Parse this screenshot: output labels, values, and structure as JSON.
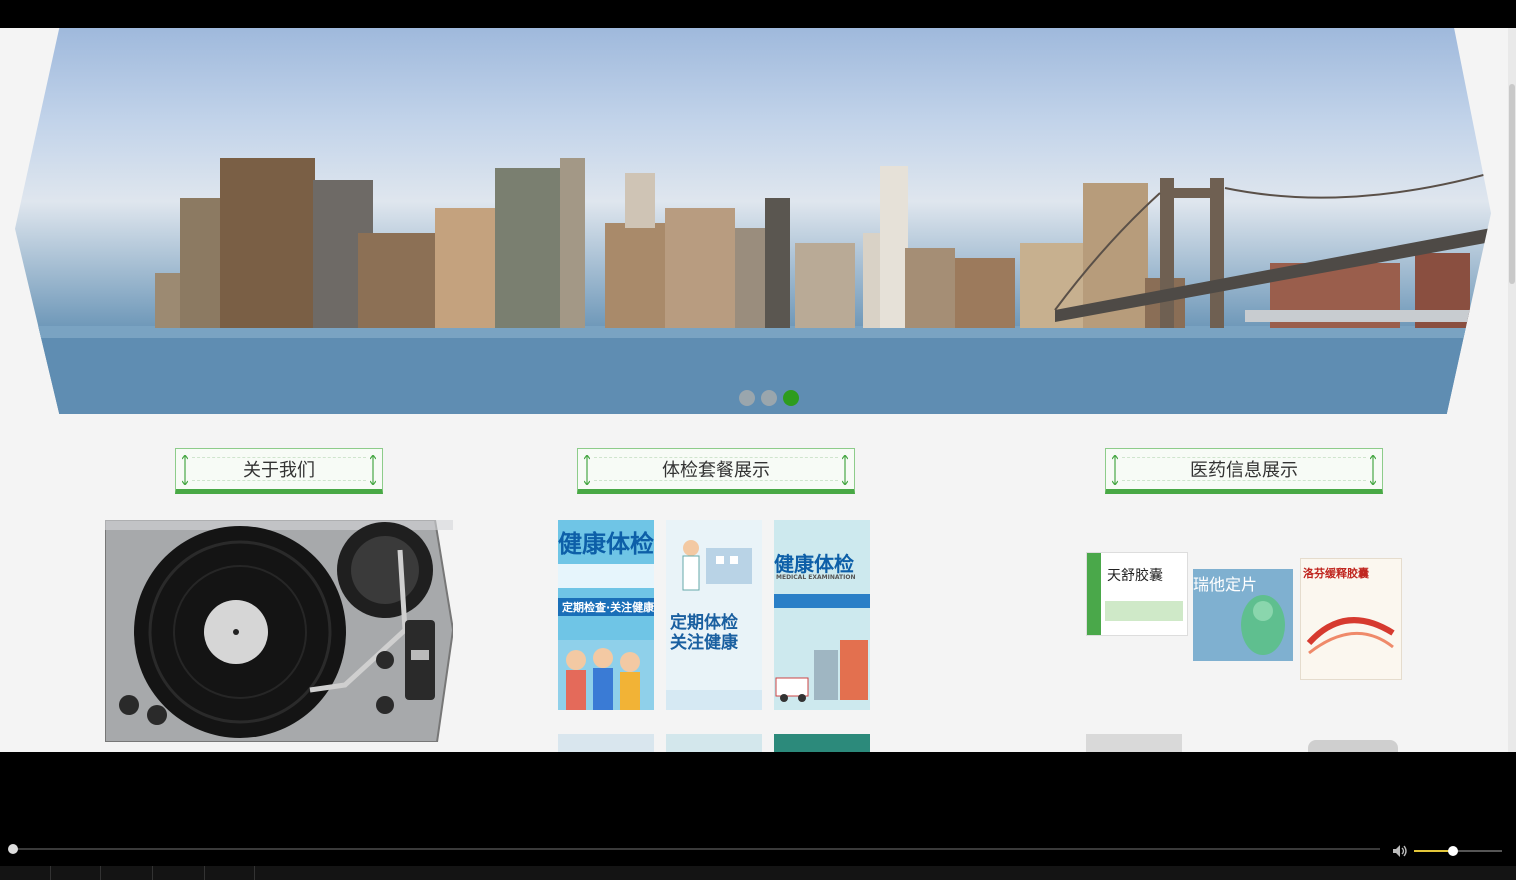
{
  "sections": {
    "about_title": "关于我们",
    "packages_title": "体检套餐展示",
    "medicine_title": "医药信息展示"
  },
  "carousel": {
    "active_index": 2,
    "count": 3,
    "active_color": "#2e9c1e"
  },
  "package_cards": [
    {
      "line1": "健康体检",
      "line2": "定期检查·关注健康"
    },
    {
      "line1": "定期体检",
      "line2": "关注健康"
    },
    {
      "line1": "健康体检",
      "line2": "MEDICAL EXAMINATION"
    }
  ],
  "medicine_items": [
    {
      "name": "天舒胶囊"
    },
    {
      "name": "瑞他定片"
    },
    {
      "name": "洛芬缓释胶囊"
    }
  ],
  "player": {
    "progress": 0.0,
    "volume": 0.45
  },
  "colors": {
    "accent_green": "#48a845",
    "header_border": "#8dcc8a"
  }
}
